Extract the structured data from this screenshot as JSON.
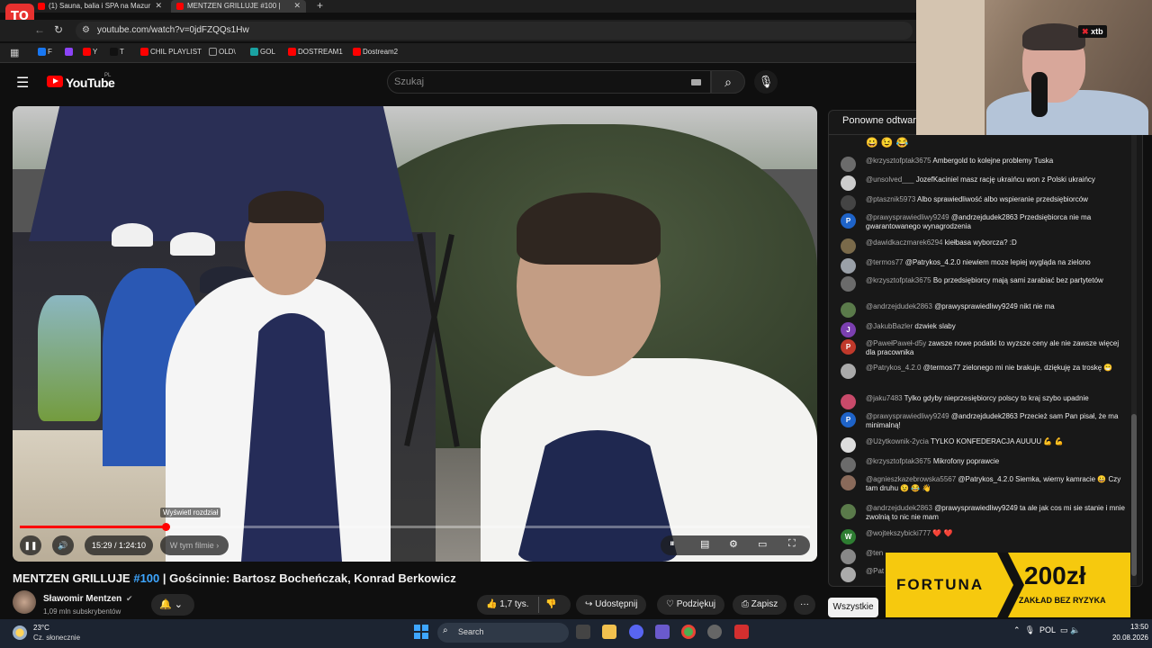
{
  "browser": {
    "logo_text": "TO",
    "tabs": [
      {
        "title": "(1) Sauna, balia i SPA na Mazur",
        "active": false
      },
      {
        "title": "MENTZEN GRILLUJE #100 |",
        "active": true
      }
    ],
    "new_tab": "+",
    "url": "youtube.com/watch?v=0jdFZQQs1Hw",
    "bookmarks": [
      {
        "label": "F",
        "color": "#1877f2"
      },
      {
        "label": "",
        "color": "#8c44f7"
      },
      {
        "label": "Y",
        "color": "#ff0000"
      },
      {
        "label": "T",
        "color": "#111111"
      },
      {
        "label": "CHIL PLAYLIST",
        "color": "#ff0000"
      },
      {
        "label": "OLD\\",
        "color": "#999999"
      },
      {
        "label": "GOL",
        "color": "#1aa1a1"
      },
      {
        "label": "DOSTREAM1",
        "color": "#ff0000"
      },
      {
        "label": "Dostream2",
        "color": "#ff0000"
      }
    ]
  },
  "youtube": {
    "logo": "YouTube",
    "country": "PL",
    "search_placeholder": "Szukaj"
  },
  "video": {
    "chapter_tooltip": "Wyświetl rozdział",
    "progress": 0.185,
    "time": "15:29 / 1:24:10",
    "chapter_button": "W tym filmie",
    "title_tag": "MENTZEN GRILLUJE ",
    "title_hash": "#100",
    "title_rest": " | Gościnnie: Bartosz Bocheńczak, Konrad Berkowicz"
  },
  "channel": {
    "name": "Sławomir Mentzen",
    "subscribers": "1,09 mln subskrybentów"
  },
  "actions": {
    "likes": "1,7 tys.",
    "share": "Udostępnij",
    "thanks": "Podziękuj",
    "save": "Zapisz",
    "more": "···"
  },
  "chat": {
    "title": "Ponowne odtwar",
    "top_emojis": "😀 😉 😂",
    "filter_button": "Wszystkie",
    "messages": [
      {
        "author": "@krzysztofptak3675",
        "text": "Ambergold to kolejne problemy Tuska",
        "avatar_color": "#6b6b6b",
        "avatar_letter": ""
      },
      {
        "author": "@unsolved___",
        "text": "JozefKaciniel masz rację ukraińcu won z Polski ukraińcy",
        "avatar_color": "#cccccc",
        "avatar_letter": ""
      },
      {
        "author": "@ptasznik5973",
        "text": "Albo sprawiedliwość albo wspieranie przedsiębiorców",
        "avatar_color": "#444444",
        "avatar_letter": ""
      },
      {
        "author": "@prawysprawiedliwy9249",
        "text": "@andrzejdudek2863 Przedsiębiorca nie ma gwarantowanego wynagrodzenia",
        "avatar_color": "#1e63c8",
        "avatar_letter": "P"
      },
      {
        "author": "@dawidkaczmarek6294",
        "text": "kiełbasa wyborcza? :D",
        "avatar_color": "#7a6a4a",
        "avatar_letter": ""
      },
      {
        "author": "@termos77",
        "text": "@Patrykos_4.2.0 niewiem moze lepiej wygląda na zielono",
        "avatar_color": "#9aa0a8",
        "avatar_letter": ""
      },
      {
        "author": "@krzysztofptak3675",
        "text": "Bo przedsiębiorcy mają sami zarabiać bez partytetów",
        "avatar_color": "#6b6b6b",
        "avatar_letter": ""
      },
      {
        "author": "@andrzejdudek2863",
        "text": "@prawysprawiedliwy9249 nikt nie ma",
        "avatar_color": "#5a7a4a",
        "avatar_letter": ""
      },
      {
        "author": "@JakubBazler",
        "text": "dzwiek slaby",
        "avatar_color": "#7b3fb0",
        "avatar_letter": "J"
      },
      {
        "author": "@PawełPaweł-d5y",
        "text": "zawsze nowe podatki to wyzsze ceny ale nie zawsze więcej dla pracownika",
        "avatar_color": "#c0392b",
        "avatar_letter": "P"
      },
      {
        "author": "@Patrykos_4.2.0",
        "text": "@termos77 zielonego mi nie brakuje, dziękuję za troskę 😁",
        "avatar_color": "#aaaaaa",
        "avatar_letter": ""
      },
      {
        "author": "@jaku7483",
        "text": "Tylko gdyby nieprzesiębiorcy polscy to kraj szybo upadnie",
        "avatar_color": "#c84a6a",
        "avatar_letter": ""
      },
      {
        "author": "@prawysprawiedliwy9249",
        "text": "@andrzejdudek2863 Przecież sam Pan pisał, że ma minimalną!",
        "avatar_color": "#1e63c8",
        "avatar_letter": "P"
      },
      {
        "author": "@Użytkownik-2ycia",
        "text": "TYLKO KONFEDERACJA AUUUU 💪 💪",
        "avatar_color": "#dddddd",
        "avatar_letter": ""
      },
      {
        "author": "@krzysztofptak3675",
        "text": "Mikrofony poprawcie",
        "avatar_color": "#6b6b6b",
        "avatar_letter": ""
      },
      {
        "author": "@agnieszkazebrowska5567",
        "text": "@Patrykos_4.2.0 Siemka, wierny kamracie 😀 Czy tam druhu 😉 😂 👋",
        "avatar_color": "#8a6a5a",
        "avatar_letter": ""
      },
      {
        "author": "@andrzejdudek2863",
        "text": "@prawysprawiedliwy9249 ta ale jak cos mi sie stanie i mnie zwolnią to nic nie mam",
        "avatar_color": "#5a7a4a",
        "avatar_letter": ""
      },
      {
        "author": "@wojtekszybicki777",
        "text": "❤️ ❤️",
        "avatar_color": "#2e7d32",
        "avatar_letter": "W"
      },
      {
        "author": "@ten",
        "text": "",
        "avatar_color": "#888888",
        "avatar_letter": ""
      },
      {
        "author": "@Pat",
        "text": "",
        "avatar_color": "#aaaaaa",
        "avatar_letter": ""
      }
    ]
  },
  "overlay": {
    "xtb": "xtb",
    "fortuna_name": "FORTUNA",
    "fortuna_amount": "200zł",
    "fortuna_sub": "ZAKŁAD BEZ RYZYKA"
  },
  "taskbar": {
    "temp": "23°C",
    "weather": "Cz. słonecznie",
    "search": "Search",
    "lang": "POL",
    "time": "13:50",
    "date": "20.08.2026"
  },
  "colors": {
    "accent": "#ff0000",
    "link": "#3ea6ff"
  }
}
